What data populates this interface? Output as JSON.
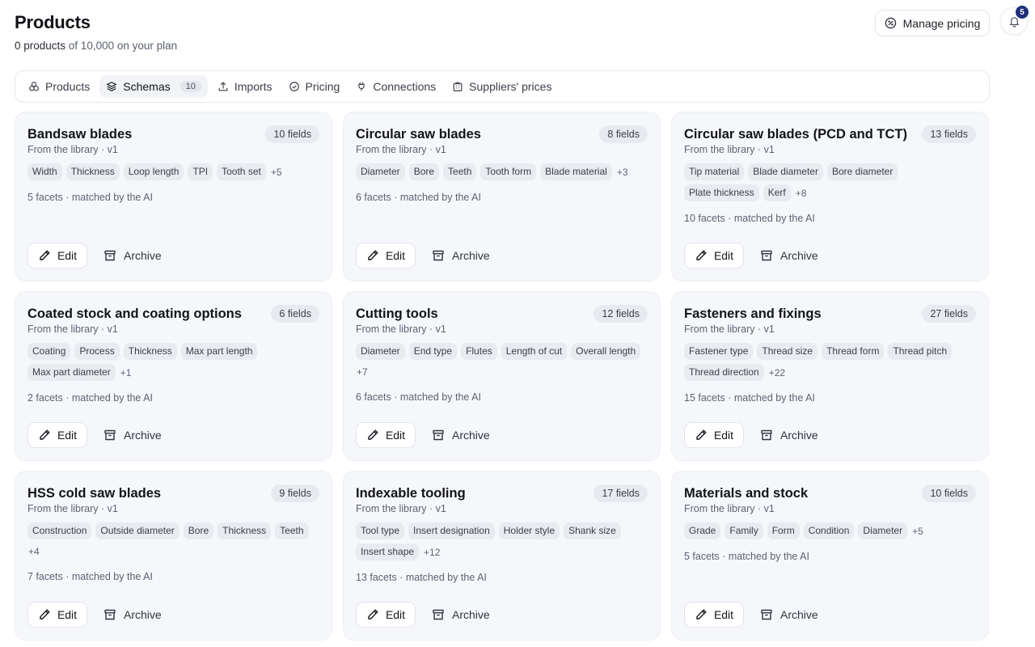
{
  "header": {
    "title": "Products",
    "subtitle_count": "0 products",
    "subtitle_rest": " of 10,000 on your plan",
    "manage_pricing_label": "Manage pricing",
    "notification_count": "5"
  },
  "tabs": [
    {
      "label": "Products",
      "icon": "boxes-icon"
    },
    {
      "label": "Schemas",
      "icon": "layers-icon",
      "count": "10",
      "active": true
    },
    {
      "label": "Imports",
      "icon": "upload-icon"
    },
    {
      "label": "Pricing",
      "icon": "percent-badge-icon"
    },
    {
      "label": "Connections",
      "icon": "plug-icon"
    },
    {
      "label": "Suppliers' prices",
      "icon": "building-icon"
    }
  ],
  "card_actions": {
    "edit_label": "Edit",
    "archive_label": "Archive"
  },
  "cards": [
    {
      "title": "Bandsaw blades",
      "fields": "10 fields",
      "source": "From the library · v1",
      "chips": [
        "Width",
        "Thickness",
        "Loop length",
        "TPI",
        "Tooth set"
      ],
      "more": "+5",
      "facets": "5 facets · matched by the AI"
    },
    {
      "title": "Circular saw blades",
      "fields": "8 fields",
      "source": "From the library · v1",
      "chips": [
        "Diameter",
        "Bore",
        "Teeth",
        "Tooth form",
        "Blade material"
      ],
      "more": "+3",
      "facets": "6 facets · matched by the AI"
    },
    {
      "title": "Circular saw blades (PCD and TCT)",
      "fields": "13 fields",
      "source": "From the library · v1",
      "chips": [
        "Tip material",
        "Blade diameter",
        "Bore diameter",
        "Plate thickness",
        "Kerf"
      ],
      "more": "+8",
      "facets": "10 facets · matched by the AI"
    },
    {
      "title": "Coated stock and coating options",
      "fields": "6 fields",
      "source": "From the library · v1",
      "chips": [
        "Coating",
        "Process",
        "Thickness",
        "Max part length",
        "Max part diameter"
      ],
      "more": "+1",
      "facets": "2 facets · matched by the AI"
    },
    {
      "title": "Cutting tools",
      "fields": "12 fields",
      "source": "From the library · v1",
      "chips": [
        "Diameter",
        "End type",
        "Flutes",
        "Length of cut",
        "Overall length"
      ],
      "more": "+7",
      "facets": "6 facets · matched by the AI"
    },
    {
      "title": "Fasteners and fixings",
      "fields": "27 fields",
      "source": "From the library · v1",
      "chips": [
        "Fastener type",
        "Thread size",
        "Thread form",
        "Thread pitch",
        "Thread direction"
      ],
      "more": "+22",
      "facets": "15 facets · matched by the AI"
    },
    {
      "title": "HSS cold saw blades",
      "fields": "9 fields",
      "source": "From the library · v1",
      "chips": [
        "Construction",
        "Outside diameter",
        "Bore",
        "Thickness",
        "Teeth"
      ],
      "more": "+4",
      "facets": "7 facets · matched by the AI"
    },
    {
      "title": "Indexable tooling",
      "fields": "17 fields",
      "source": "From the library · v1",
      "chips": [
        "Tool type",
        "Insert designation",
        "Holder style",
        "Shank size",
        "Insert shape"
      ],
      "more": "+12",
      "facets": "13 facets · matched by the AI"
    },
    {
      "title": "Materials and stock",
      "fields": "10 fields",
      "source": "From the library · v1",
      "chips": [
        "Grade",
        "Family",
        "Form",
        "Condition",
        "Diameter"
      ],
      "more": "+5",
      "facets": "5 facets · matched by the AI"
    }
  ]
}
